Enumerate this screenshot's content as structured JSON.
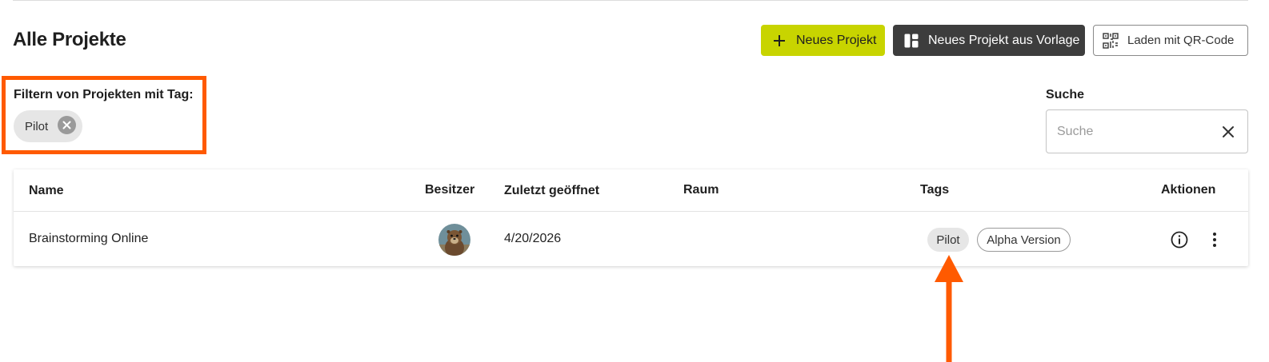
{
  "header": {
    "title": "Alle Projekte",
    "new_project_label": "Neues Projekt",
    "from_template_label": "Neues Projekt aus Vorlage",
    "qr_label": "Laden mit QR-Code"
  },
  "filter": {
    "label": "Filtern von Projekten mit Tag:",
    "active_tags": [
      {
        "label": "Pilot"
      }
    ]
  },
  "search": {
    "label": "Suche",
    "placeholder": "Suche",
    "value": ""
  },
  "table": {
    "columns": [
      "Name",
      "Besitzer",
      "Zuletzt geöffnet",
      "Raum",
      "Tags",
      "Aktionen"
    ],
    "rows": [
      {
        "name": "Brainstorming Online",
        "owner_avatar": "marmot-avatar",
        "last_opened": "4/20/2026",
        "room": "",
        "tags": [
          "Pilot",
          "Alpha Version"
        ]
      }
    ]
  },
  "icons": {
    "new_project": "plus-icon",
    "template": "template-icon",
    "qr": "qr-code-icon",
    "chip_remove": "close-circle-icon",
    "search_clear": "close-icon",
    "info": "info-icon",
    "more": "more-vertical-icon"
  },
  "colors": {
    "accent": "#c8d400",
    "dark_button": "#3d3d3d",
    "annotation": "#ff5a00"
  }
}
